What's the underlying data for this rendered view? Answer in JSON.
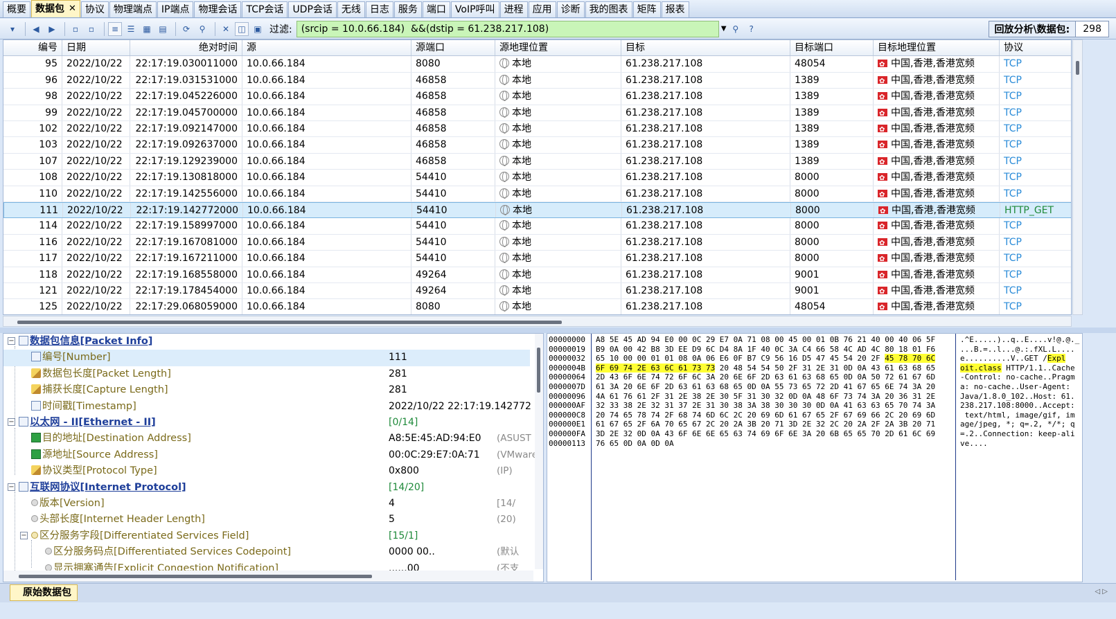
{
  "tabs": [
    {
      "label": "概要"
    },
    {
      "label": "数据包",
      "active": true
    },
    {
      "label": "协议"
    },
    {
      "label": "物理端点"
    },
    {
      "label": "IP端点"
    },
    {
      "label": "物理会话"
    },
    {
      "label": "TCP会话"
    },
    {
      "label": "UDP会话"
    },
    {
      "label": "无线"
    },
    {
      "label": "日志"
    },
    {
      "label": "服务"
    },
    {
      "label": "端口"
    },
    {
      "label": "VoIP呼叫"
    },
    {
      "label": "进程"
    },
    {
      "label": "应用"
    },
    {
      "label": "诊断"
    },
    {
      "label": "我的图表"
    },
    {
      "label": "矩阵"
    },
    {
      "label": "报表"
    }
  ],
  "active_tab_close": "✕",
  "toolbar": {
    "filter_label": "过滤:",
    "filter_value": "(srcip = 10.0.66.184)  &&(dstip = 61.238.217.108)",
    "analysis_label": "回放分析\\数据包:",
    "analysis_count": "298"
  },
  "table": {
    "columns": [
      "编号",
      "日期",
      "绝对时间",
      "源",
      "源端口",
      "源地理位置",
      "目标",
      "目标端口",
      "目标地理位置",
      "协议"
    ],
    "rows": [
      {
        "num": "95",
        "date": "2022/10/22",
        "time": "22:17:19.030011000",
        "src": "10.0.66.184",
        "sport": "8080",
        "sgeo": "本地",
        "dst": "61.238.217.108",
        "dport": "48054",
        "dgeo": "中国,香港,香港宽频",
        "proto": "TCP"
      },
      {
        "num": "96",
        "date": "2022/10/22",
        "time": "22:17:19.031531000",
        "src": "10.0.66.184",
        "sport": "46858",
        "sgeo": "本地",
        "dst": "61.238.217.108",
        "dport": "1389",
        "dgeo": "中国,香港,香港宽频",
        "proto": "TCP"
      },
      {
        "num": "98",
        "date": "2022/10/22",
        "time": "22:17:19.045226000",
        "src": "10.0.66.184",
        "sport": "46858",
        "sgeo": "本地",
        "dst": "61.238.217.108",
        "dport": "1389",
        "dgeo": "中国,香港,香港宽频",
        "proto": "TCP"
      },
      {
        "num": "99",
        "date": "2022/10/22",
        "time": "22:17:19.045700000",
        "src": "10.0.66.184",
        "sport": "46858",
        "sgeo": "本地",
        "dst": "61.238.217.108",
        "dport": "1389",
        "dgeo": "中国,香港,香港宽频",
        "proto": "TCP"
      },
      {
        "num": "102",
        "date": "2022/10/22",
        "time": "22:17:19.092147000",
        "src": "10.0.66.184",
        "sport": "46858",
        "sgeo": "本地",
        "dst": "61.238.217.108",
        "dport": "1389",
        "dgeo": "中国,香港,香港宽频",
        "proto": "TCP"
      },
      {
        "num": "103",
        "date": "2022/10/22",
        "time": "22:17:19.092637000",
        "src": "10.0.66.184",
        "sport": "46858",
        "sgeo": "本地",
        "dst": "61.238.217.108",
        "dport": "1389",
        "dgeo": "中国,香港,香港宽频",
        "proto": "TCP"
      },
      {
        "num": "107",
        "date": "2022/10/22",
        "time": "22:17:19.129239000",
        "src": "10.0.66.184",
        "sport": "46858",
        "sgeo": "本地",
        "dst": "61.238.217.108",
        "dport": "1389",
        "dgeo": "中国,香港,香港宽频",
        "proto": "TCP"
      },
      {
        "num": "108",
        "date": "2022/10/22",
        "time": "22:17:19.130818000",
        "src": "10.0.66.184",
        "sport": "54410",
        "sgeo": "本地",
        "dst": "61.238.217.108",
        "dport": "8000",
        "dgeo": "中国,香港,香港宽频",
        "proto": "TCP"
      },
      {
        "num": "110",
        "date": "2022/10/22",
        "time": "22:17:19.142556000",
        "src": "10.0.66.184",
        "sport": "54410",
        "sgeo": "本地",
        "dst": "61.238.217.108",
        "dport": "8000",
        "dgeo": "中国,香港,香港宽频",
        "proto": "TCP"
      },
      {
        "num": "111",
        "date": "2022/10/22",
        "time": "22:17:19.142772000",
        "src": "10.0.66.184",
        "sport": "54410",
        "sgeo": "本地",
        "dst": "61.238.217.108",
        "dport": "8000",
        "dgeo": "中国,香港,香港宽频",
        "proto": "HTTP_GET",
        "selected": true
      },
      {
        "num": "114",
        "date": "2022/10/22",
        "time": "22:17:19.158997000",
        "src": "10.0.66.184",
        "sport": "54410",
        "sgeo": "本地",
        "dst": "61.238.217.108",
        "dport": "8000",
        "dgeo": "中国,香港,香港宽频",
        "proto": "TCP"
      },
      {
        "num": "116",
        "date": "2022/10/22",
        "time": "22:17:19.167081000",
        "src": "10.0.66.184",
        "sport": "54410",
        "sgeo": "本地",
        "dst": "61.238.217.108",
        "dport": "8000",
        "dgeo": "中国,香港,香港宽频",
        "proto": "TCP"
      },
      {
        "num": "117",
        "date": "2022/10/22",
        "time": "22:17:19.167211000",
        "src": "10.0.66.184",
        "sport": "54410",
        "sgeo": "本地",
        "dst": "61.238.217.108",
        "dport": "8000",
        "dgeo": "中国,香港,香港宽频",
        "proto": "TCP"
      },
      {
        "num": "118",
        "date": "2022/10/22",
        "time": "22:17:19.168558000",
        "src": "10.0.66.184",
        "sport": "49264",
        "sgeo": "本地",
        "dst": "61.238.217.108",
        "dport": "9001",
        "dgeo": "中国,香港,香港宽频",
        "proto": "TCP"
      },
      {
        "num": "121",
        "date": "2022/10/22",
        "time": "22:17:19.178454000",
        "src": "10.0.66.184",
        "sport": "49264",
        "sgeo": "本地",
        "dst": "61.238.217.108",
        "dport": "9001",
        "dgeo": "中国,香港,香港宽频",
        "proto": "TCP"
      },
      {
        "num": "125",
        "date": "2022/10/22",
        "time": "22:17:29.068059000",
        "src": "10.0.66.184",
        "sport": "8080",
        "sgeo": "本地",
        "dst": "61.238.217.108",
        "dport": "48054",
        "dgeo": "中国,香港,香港宽频",
        "proto": "TCP"
      }
    ]
  },
  "detail": [
    {
      "label": "数据包信息[Packet Info]",
      "level": 0,
      "kind": "section",
      "toggle": "minus",
      "icon": "packet-info-icon"
    },
    {
      "label": "编号[Number]",
      "level": 2,
      "kind": "field",
      "icon": "doc-icon",
      "value": "111",
      "selected": true
    },
    {
      "label": "数据包长度[Packet Length]",
      "level": 2,
      "kind": "field",
      "icon": "pencil-icon",
      "value": "281"
    },
    {
      "label": "捕获长度[Capture Length]",
      "level": 2,
      "kind": "field",
      "icon": "pencil-icon",
      "value": "281"
    },
    {
      "label": "时间戳[Timestamp]",
      "level": 2,
      "kind": "field",
      "icon": "doc-icon",
      "value": "2022/10/22 22:17:19.142772"
    },
    {
      "label": "以太网 - II[Ethernet - II]",
      "level": 0,
      "kind": "section",
      "toggle": "minus",
      "icon": "doc-icon",
      "value": "[0/14]",
      "value_kind": "range"
    },
    {
      "label": "目的地址[Destination Address]",
      "level": 2,
      "kind": "field",
      "icon": "mac-icon",
      "value": "A8:5E:45:AD:94:E0",
      "extra": "(ASUST"
    },
    {
      "label": "源地址[Source Address]",
      "level": 2,
      "kind": "field",
      "icon": "mac-icon",
      "value": "00:0C:29:E7:0A:71",
      "extra": "(VMware"
    },
    {
      "label": "协议类型[Protocol Type]",
      "level": 2,
      "kind": "field",
      "icon": "pencil-icon",
      "value": "0x800",
      "extra": "(IP)"
    },
    {
      "label": "互联网协议[Internet Protocol]",
      "level": 0,
      "kind": "section",
      "toggle": "minus",
      "icon": "doc-icon",
      "value": "[14/20]",
      "value_kind": "range"
    },
    {
      "label": "版本[Version]",
      "level": 2,
      "kind": "field2",
      "icon": "circle-gray-icon",
      "value": "4",
      "extra": "[14/"
    },
    {
      "label": "头部长度[Internet Header Length]",
      "level": 2,
      "kind": "field2",
      "icon": "circle-gray-icon",
      "value": "5",
      "extra": "(20)"
    },
    {
      "label": "区分服务字段[Differentiated Services Field]",
      "level": 1,
      "kind": "field",
      "toggle": "minus",
      "icon": "circle-yellow-icon",
      "value": "[15/1]",
      "value_kind": "range"
    },
    {
      "label": "区分服务码点[Differentiated Services Codepoint]",
      "level": 3,
      "kind": "field",
      "icon": "circle-gray-icon",
      "value": "0000 00..",
      "extra": "(默认"
    },
    {
      "label": "显示拥塞通告[Explicit Congestion Notification]",
      "level": 3,
      "kind": "field",
      "icon": "circle-gray-icon",
      "value": "......00",
      "extra": "(不支"
    }
  ],
  "hex": [
    {
      "off": "00000000",
      "pre": "A8 5E 45 AD 94 E0 00 0C 29 E7 0A 71 08 00 45 00 01 0B 76 21 40 00 40 06 5F",
      "hl": "",
      "post": "",
      "ascii_pre": ".^E.....)..q..E....v!@.@._",
      "ascii_hl": "",
      "ascii_post": ""
    },
    {
      "off": "00000019",
      "pre": "B9 0A 00 42 B8 3D EE D9 6C D4 8A 1F 40 0C 3A C4 66 58 4C AD 4C 80 18 01 F6",
      "hl": "",
      "post": "",
      "ascii_pre": "...B.=..l...@.:.fXL.L....",
      "ascii_hl": "",
      "ascii_post": ""
    },
    {
      "off": "00000032",
      "pre": "65 10 00 00 01 01 08 0A 06 E6 0F B7 C9 56 16 D5 47 45 54 20 2F ",
      "hl": "45 78 70 6C",
      "post": "",
      "ascii_pre": "e..........V..GET /",
      "ascii_hl": "Expl",
      "ascii_post": ""
    },
    {
      "off": "0000004B",
      "pre": "",
      "hl": "6F 69 74 2E 63 6C 61 73 73",
      "post": " 20 48 54 54 50 2F 31 2E 31 0D 0A 43 61 63 68 65",
      "ascii_pre": "",
      "ascii_hl": "oit.class",
      "ascii_post": " HTTP/1.1..Cache"
    },
    {
      "off": "00000064",
      "pre": "2D 43 6F 6E 74 72 6F 6C 3A 20 6E 6F 2D 63 61 63 68 65 0D 0A 50 72 61 67 6D",
      "hl": "",
      "post": "",
      "ascii_pre": "-Control: no-cache..Pragm",
      "ascii_hl": "",
      "ascii_post": ""
    },
    {
      "off": "0000007D",
      "pre": "61 3A 20 6E 6F 2D 63 61 63 68 65 0D 0A 55 73 65 72 2D 41 67 65 6E 74 3A 20",
      "hl": "",
      "post": "",
      "ascii_pre": "a: no-cache..User-Agent: ",
      "ascii_hl": "",
      "ascii_post": ""
    },
    {
      "off": "00000096",
      "pre": "4A 61 76 61 2F 31 2E 38 2E 30 5F 31 30 32 0D 0A 48 6F 73 74 3A 20 36 31 2E",
      "hl": "",
      "post": "",
      "ascii_pre": "Java/1.8.0_102..Host: 61.",
      "ascii_hl": "",
      "ascii_post": ""
    },
    {
      "off": "000000AF",
      "pre": "32 33 38 2E 32 31 37 2E 31 30 38 3A 38 30 30 30 0D 0A 41 63 63 65 70 74 3A",
      "hl": "",
      "post": "",
      "ascii_pre": "238.217.108:8000..Accept:",
      "ascii_hl": "",
      "ascii_post": ""
    },
    {
      "off": "000000C8",
      "pre": "20 74 65 78 74 2F 68 74 6D 6C 2C 20 69 6D 61 67 65 2F 67 69 66 2C 20 69 6D",
      "hl": "",
      "post": "",
      "ascii_pre": " text/html, image/gif, im",
      "ascii_hl": "",
      "ascii_post": ""
    },
    {
      "off": "000000E1",
      "pre": "61 67 65 2F 6A 70 65 67 2C 20 2A 3B 20 71 3D 2E 32 2C 20 2A 2F 2A 3B 20 71",
      "hl": "",
      "post": "",
      "ascii_pre": "age/jpeg, *; q=.2, */*; q",
      "ascii_hl": "",
      "ascii_post": ""
    },
    {
      "off": "000000FA",
      "pre": "3D 2E 32 0D 0A 43 6F 6E 6E 65 63 74 69 6F 6E 3A 20 6B 65 65 70 2D 61 6C 69",
      "hl": "",
      "post": "",
      "ascii_pre": "=.2..Connection: keep-ali",
      "ascii_hl": "",
      "ascii_post": ""
    },
    {
      "off": "00000113",
      "pre": "76 65 0D 0A 0D 0A",
      "hl": "",
      "post": "",
      "ascii_pre": "ve....",
      "ascii_hl": "",
      "ascii_post": ""
    }
  ],
  "bottom_tab": "原始数据包",
  "bottom_arrows": "◁ ▷",
  "colors": {
    "filter_bg": "#c9f5b8",
    "selected_row": "#d6ecfb",
    "tcp": "#2a8bd8",
    "http": "#1f8a3a",
    "hex_highlight": "#ffff33"
  }
}
